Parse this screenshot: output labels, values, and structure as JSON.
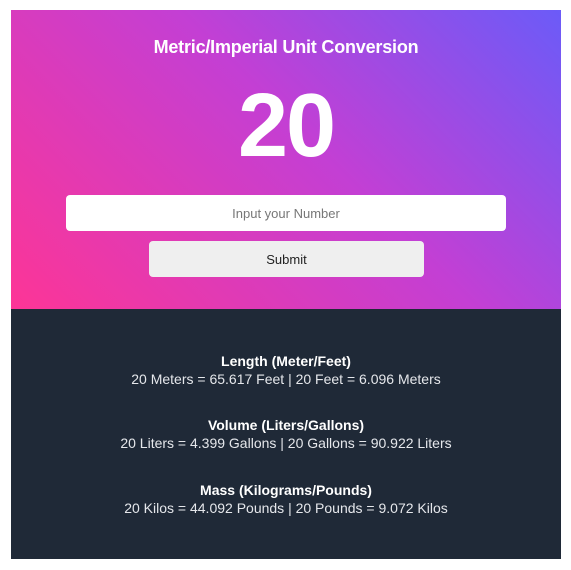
{
  "header": {
    "title": "Metric/Imperial Unit Conversion",
    "current_value": "20"
  },
  "form": {
    "input_placeholder": "Input your Number",
    "input_value": "",
    "submit_label": "Submit"
  },
  "results": [
    {
      "title": "Length (Meter/Feet)",
      "text": "20 Meters = 65.617 Feet | 20 Feet = 6.096 Meters"
    },
    {
      "title": "Volume (Liters/Gallons)",
      "text": "20 Liters = 4.399 Gallons | 20 Gallons = 90.922 Liters"
    },
    {
      "title": "Mass (Kilograms/Pounds)",
      "text": "20 Kilos = 44.092 Pounds | 20 Pounds = 9.072 Kilos"
    }
  ],
  "colors": {
    "gradient_start": "#fd3596",
    "gradient_mid": "#c33fd4",
    "gradient_end": "#6b5bf8",
    "results_background": "#1f2937"
  }
}
